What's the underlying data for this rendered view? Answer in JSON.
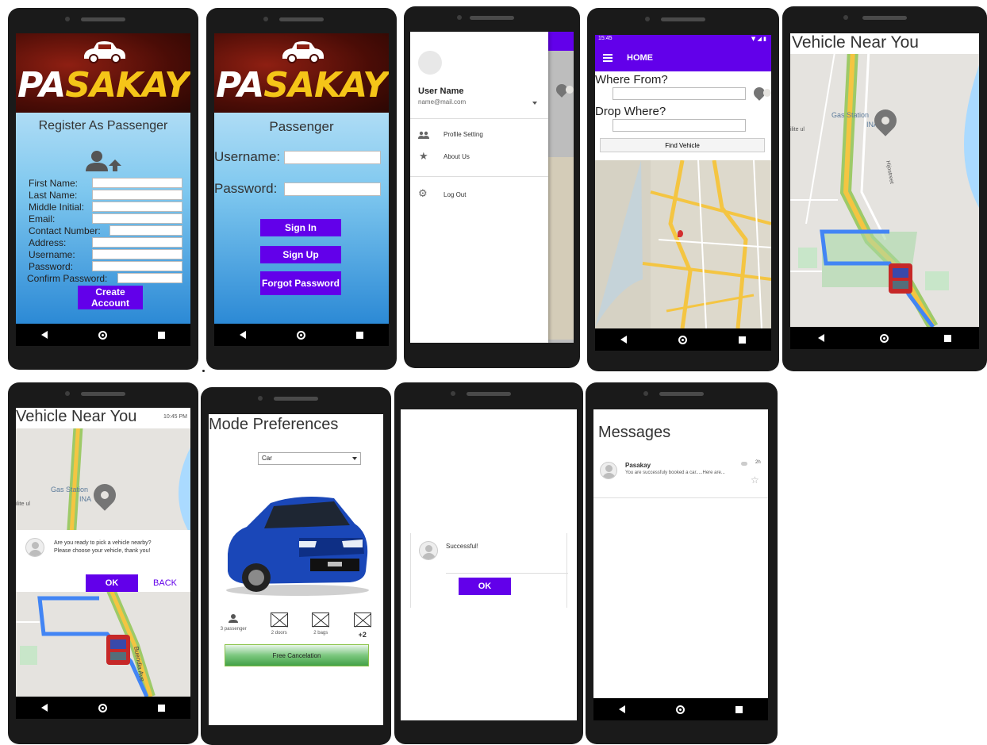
{
  "register": {
    "logo_prefix": "PA",
    "logo_rest": "SAKAY",
    "title": "Register As Passenger",
    "fields": [
      "First Name:",
      "Last Name:",
      "Middle Initial:",
      "Email:",
      "Contact Number:",
      "Address:",
      "Username:",
      "Password:",
      "Confirm Password:"
    ],
    "create_label": "Create Account"
  },
  "login": {
    "logo_prefix": "PA",
    "logo_rest": "SAKAY",
    "title": "Passenger",
    "username_label": "Username:",
    "password_label": "Password:",
    "signin_label": "Sign In",
    "signup_label": "Sign Up",
    "forgot_label": "Forgot Password"
  },
  "drawer": {
    "user_name": "User Name",
    "user_email": "name@mail.com",
    "items": [
      "Profile Setting",
      "About Us"
    ],
    "logout_label": "Log Out"
  },
  "home": {
    "status_time": "15:45",
    "app_title": "HOME",
    "where_from_label": "Where From?",
    "drop_where_label": "Drop Where?",
    "find_label": "Find Vehicle"
  },
  "near": {
    "title": "Vehicle Near You",
    "gas_label": "Gas Station",
    "gas_sub": "INA",
    "road_label": "Hijostreet",
    "ilite_label": "ilite ul"
  },
  "near_dialog": {
    "title": "Vehicle Near You",
    "time": "10:45 PM",
    "gas_label": "Gas Station",
    "gas_sub": "INA",
    "ilite_label": "ilite ul",
    "message_line1": "Are you ready to pick a vehicle nearby?",
    "message_line2": "Please choose your vehicle, thank you!",
    "ok_label": "OK",
    "back_label": "BACK",
    "road_label": "Buendia Ave"
  },
  "mode": {
    "title": "Mode Preferences",
    "select_value": "Car",
    "features": [
      {
        "label": "3 passenger",
        "icon": "person-icon"
      },
      {
        "label": "2 doors",
        "icon": "image-placeholder-icon"
      },
      {
        "label": "2 bags",
        "icon": "image-placeholder-icon"
      },
      {
        "label": "+2",
        "icon": "image-placeholder-icon"
      }
    ],
    "cancel_label": "Free Cancelation"
  },
  "success": {
    "message": "Successful!",
    "ok_label": "OK"
  },
  "messages": {
    "title": "Messages",
    "sender": "Pasakay",
    "preview": "You are successfuly booked a car.....Here are...",
    "time": "2h"
  },
  "colors": {
    "accent": "#6200ea",
    "logo_yellow": "#f5c518",
    "map_bg": "#e5e3df",
    "route_blue": "#4285f4",
    "green_bar": "#4caf50"
  }
}
